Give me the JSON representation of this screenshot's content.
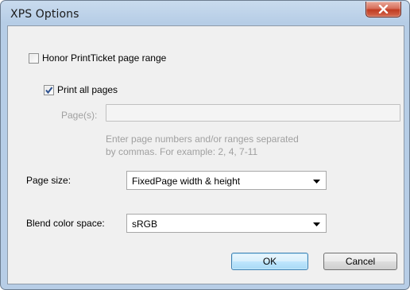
{
  "window": {
    "title": "XPS Options"
  },
  "honor_printticket": {
    "label": "Honor PrintTicket page range",
    "checked": false
  },
  "print_all_pages": {
    "label": "Print all pages",
    "checked": true
  },
  "pages": {
    "label": "Page(s):",
    "value": "",
    "enabled": false,
    "hint_line1": "Enter page numbers and/or ranges separated",
    "hint_line2": "by commas.  For example: 2, 4, 7-11"
  },
  "page_size": {
    "label": "Page size:",
    "selected": "FixedPage width & height"
  },
  "blend_color_space": {
    "label": "Blend color space:",
    "selected": "sRGB"
  },
  "buttons": {
    "ok": "OK",
    "cancel": "Cancel"
  },
  "icons": {
    "close": "close-icon",
    "checkmark": "checkmark-icon",
    "dropdown": "chevron-down-icon"
  }
}
